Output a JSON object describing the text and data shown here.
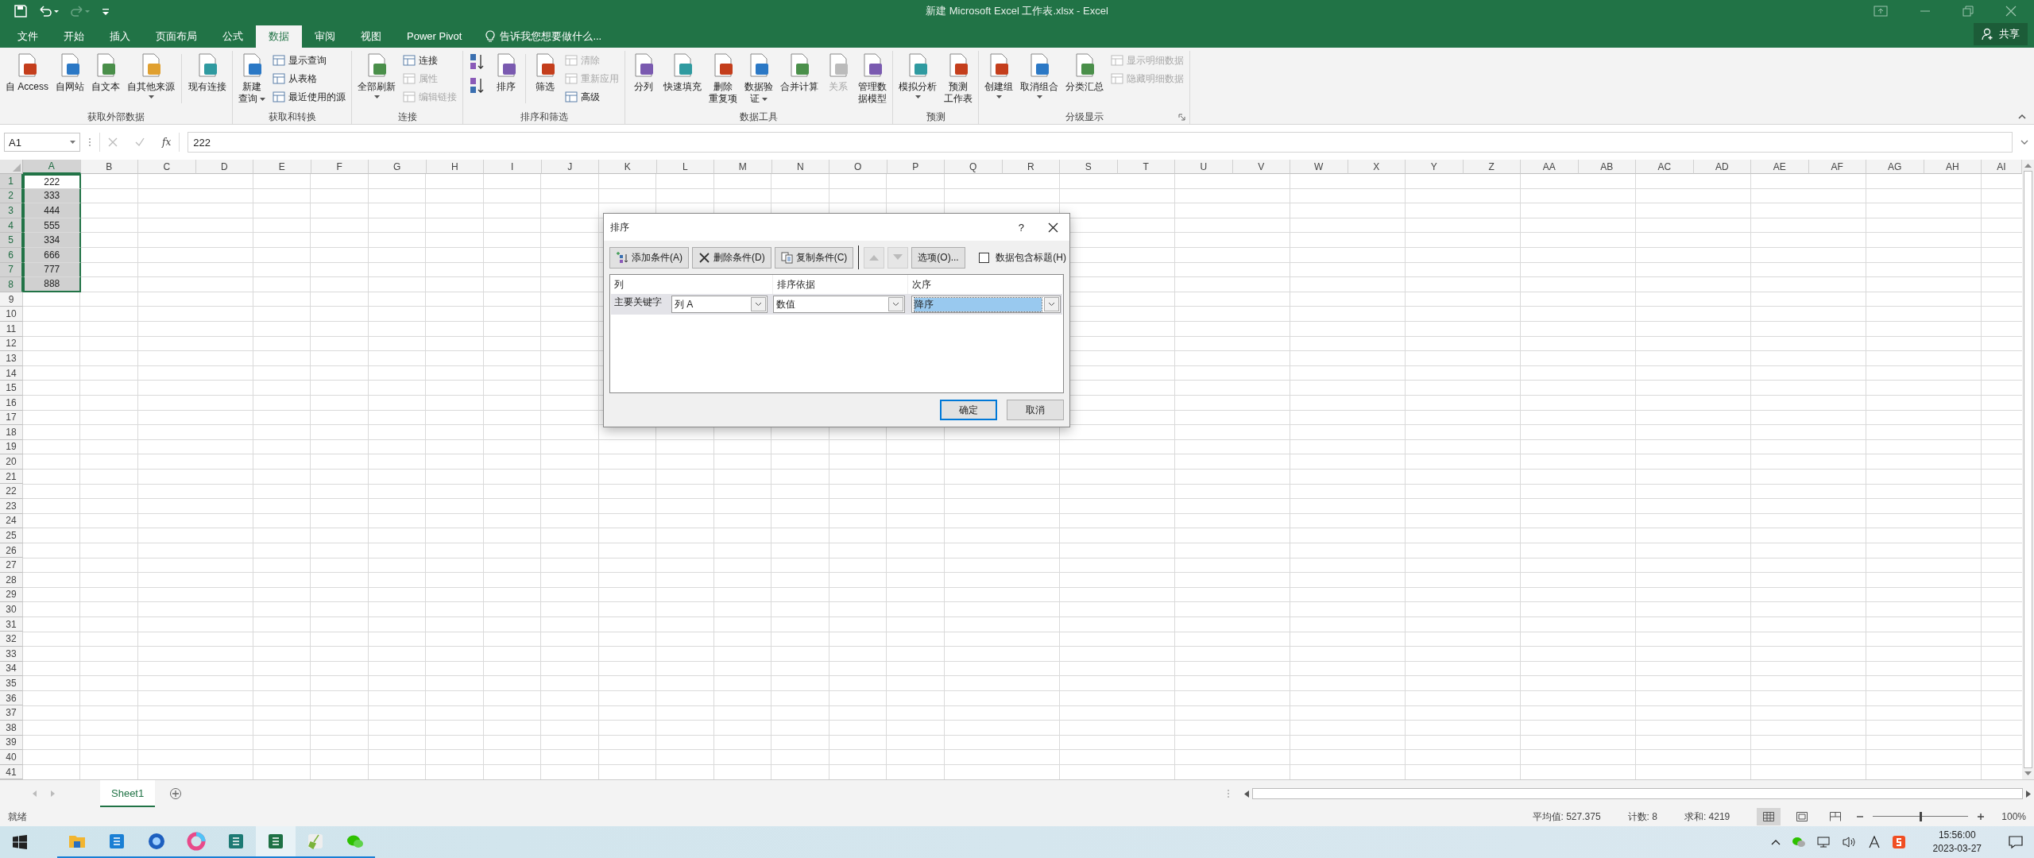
{
  "title_bar": {
    "title": "新建 Microsoft Excel 工作表.xlsx - Excel",
    "share": "共享"
  },
  "tabs": [
    {
      "label": "文件",
      "selected": false
    },
    {
      "label": "开始",
      "selected": false
    },
    {
      "label": "插入",
      "selected": false
    },
    {
      "label": "页面布局",
      "selected": false
    },
    {
      "label": "公式",
      "selected": false
    },
    {
      "label": "数据",
      "selected": true
    },
    {
      "label": "审阅",
      "selected": false
    },
    {
      "label": "视图",
      "selected": false
    },
    {
      "label": "Power Pivot",
      "selected": false
    }
  ],
  "tell_me": "告诉我您想要做什么...",
  "ribbon_groups": [
    {
      "label": "获取外部数据",
      "items": [
        {
          "kind": "large",
          "lines": [
            "自 Access"
          ],
          "disabled": false,
          "dropdown": false
        },
        {
          "kind": "large",
          "lines": [
            "自网站"
          ],
          "disabled": false,
          "dropdown": false
        },
        {
          "kind": "large",
          "lines": [
            "自文本"
          ],
          "disabled": false,
          "dropdown": false
        },
        {
          "kind": "large",
          "lines": [
            "自其他来源"
          ],
          "disabled": false,
          "dropdown": true
        },
        {
          "kind": "separator"
        },
        {
          "kind": "large",
          "lines": [
            "现有连接"
          ],
          "disabled": false,
          "dropdown": false
        }
      ]
    },
    {
      "label": "获取和转换",
      "items": [
        {
          "kind": "large",
          "lines": [
            "新建",
            "查询"
          ],
          "disabled": false,
          "dropdown": true
        },
        {
          "kind": "stack",
          "items": [
            {
              "label": "显示查询",
              "disabled": false
            },
            {
              "label": "从表格",
              "disabled": false
            },
            {
              "label": "最近使用的源",
              "disabled": false
            }
          ]
        }
      ]
    },
    {
      "label": "连接",
      "items": [
        {
          "kind": "large",
          "lines": [
            "全部刷新"
          ],
          "disabled": false,
          "dropdown": true
        },
        {
          "kind": "stack",
          "items": [
            {
              "label": "连接",
              "disabled": false
            },
            {
              "label": "属性",
              "disabled": true
            },
            {
              "label": "编辑链接",
              "disabled": true
            }
          ]
        }
      ]
    },
    {
      "label": "排序和筛选",
      "items": [
        {
          "kind": "sort_pair"
        },
        {
          "kind": "large",
          "lines": [
            "排序"
          ],
          "disabled": false,
          "dropdown": false
        },
        {
          "kind": "separator"
        },
        {
          "kind": "large",
          "lines": [
            "筛选"
          ],
          "disabled": false,
          "dropdown": false
        },
        {
          "kind": "stack",
          "items": [
            {
              "label": "清除",
              "disabled": true
            },
            {
              "label": "重新应用",
              "disabled": true
            },
            {
              "label": "高级",
              "disabled": false
            }
          ]
        }
      ]
    },
    {
      "label": "数据工具",
      "items": [
        {
          "kind": "large",
          "lines": [
            "分列"
          ],
          "disabled": false,
          "dropdown": false
        },
        {
          "kind": "large",
          "lines": [
            "快速填充"
          ],
          "disabled": false,
          "dropdown": false
        },
        {
          "kind": "large",
          "lines": [
            "删除",
            "重复项"
          ],
          "disabled": false,
          "dropdown": false
        },
        {
          "kind": "large",
          "lines": [
            "数据验",
            "证"
          ],
          "disabled": false,
          "dropdown": true
        },
        {
          "kind": "large",
          "lines": [
            "合并计算"
          ],
          "disabled": false,
          "dropdown": false
        },
        {
          "kind": "large",
          "lines": [
            "关系"
          ],
          "disabled": true,
          "dropdown": false
        },
        {
          "kind": "large",
          "lines": [
            "管理数",
            "据模型"
          ],
          "disabled": false,
          "dropdown": false
        }
      ]
    },
    {
      "label": "预测",
      "items": [
        {
          "kind": "large",
          "lines": [
            "模拟分析"
          ],
          "disabled": false,
          "dropdown": true
        },
        {
          "kind": "large",
          "lines": [
            "预测",
            "工作表"
          ],
          "disabled": false,
          "dropdown": false
        }
      ]
    },
    {
      "label": "分级显示",
      "launcher": true,
      "items": [
        {
          "kind": "large",
          "lines": [
            "创建组"
          ],
          "disabled": false,
          "dropdown": true
        },
        {
          "kind": "large",
          "lines": [
            "取消组合"
          ],
          "disabled": false,
          "dropdown": true
        },
        {
          "kind": "large",
          "lines": [
            "分类汇总"
          ],
          "disabled": false,
          "dropdown": false
        },
        {
          "kind": "stack",
          "items": [
            {
              "label": "显示明细数据",
              "disabled": true
            },
            {
              "label": "隐藏明细数据",
              "disabled": true
            }
          ]
        }
      ]
    }
  ],
  "formula_bar": {
    "name_box": "A1",
    "fx": "fx",
    "value": "222"
  },
  "sheet": {
    "columns": [
      {
        "label": "A",
        "selected": true
      },
      {
        "label": "B",
        "selected": false
      },
      {
        "label": "C",
        "selected": false
      },
      {
        "label": "D",
        "selected": false
      },
      {
        "label": "E",
        "selected": false
      },
      {
        "label": "F",
        "selected": false
      },
      {
        "label": "G",
        "selected": false
      },
      {
        "label": "H",
        "selected": false
      },
      {
        "label": "I",
        "selected": false
      },
      {
        "label": "J",
        "selected": false
      },
      {
        "label": "K",
        "selected": false
      },
      {
        "label": "L",
        "selected": false
      },
      {
        "label": "M",
        "selected": false
      },
      {
        "label": "N",
        "selected": false
      },
      {
        "label": "O",
        "selected": false
      },
      {
        "label": "P",
        "selected": false
      },
      {
        "label": "Q",
        "selected": false
      },
      {
        "label": "R",
        "selected": false
      },
      {
        "label": "S",
        "selected": false
      },
      {
        "label": "T",
        "selected": false
      },
      {
        "label": "U",
        "selected": false
      },
      {
        "label": "V",
        "selected": false
      },
      {
        "label": "W",
        "selected": false
      },
      {
        "label": "X",
        "selected": false
      },
      {
        "label": "Y",
        "selected": false
      },
      {
        "label": "Z",
        "selected": false
      },
      {
        "label": "AA",
        "selected": false
      },
      {
        "label": "AB",
        "selected": false
      },
      {
        "label": "AC",
        "selected": false
      },
      {
        "label": "AD",
        "selected": false
      },
      {
        "label": "AE",
        "selected": false
      },
      {
        "label": "AF",
        "selected": false
      },
      {
        "label": "AG",
        "selected": false
      },
      {
        "label": "AH",
        "selected": false
      },
      {
        "label": "AI",
        "selected": false
      }
    ],
    "rows": [
      {
        "label": "1",
        "selected": true,
        "cells": [
          {
            "value": "222",
            "active": true
          }
        ]
      },
      {
        "label": "2",
        "selected": true,
        "cells": [
          {
            "value": "333",
            "active": false
          }
        ]
      },
      {
        "label": "3",
        "selected": true,
        "cells": [
          {
            "value": "444",
            "active": false
          }
        ]
      },
      {
        "label": "4",
        "selected": true,
        "cells": [
          {
            "value": "555",
            "active": false
          }
        ]
      },
      {
        "label": "5",
        "selected": true,
        "cells": [
          {
            "value": "334",
            "active": false
          }
        ]
      },
      {
        "label": "6",
        "selected": true,
        "cells": [
          {
            "value": "666",
            "active": false
          }
        ]
      },
      {
        "label": "7",
        "selected": true,
        "cells": [
          {
            "value": "777",
            "active": false
          }
        ]
      },
      {
        "label": "8",
        "selected": true,
        "cells": [
          {
            "value": "888",
            "active": false
          }
        ]
      },
      {
        "label": "9",
        "selected": false
      },
      {
        "label": "10",
        "selected": false
      },
      {
        "label": "11",
        "selected": false
      },
      {
        "label": "12",
        "selected": false
      },
      {
        "label": "13",
        "selected": false
      },
      {
        "label": "14",
        "selected": false
      },
      {
        "label": "15",
        "selected": false
      },
      {
        "label": "16",
        "selected": false
      },
      {
        "label": "17",
        "selected": false
      },
      {
        "label": "18",
        "selected": false
      },
      {
        "label": "19",
        "selected": false
      },
      {
        "label": "20",
        "selected": false
      },
      {
        "label": "21",
        "selected": false
      },
      {
        "label": "22",
        "selected": false
      },
      {
        "label": "23",
        "selected": false
      },
      {
        "label": "24",
        "selected": false
      },
      {
        "label": "25",
        "selected": false
      },
      {
        "label": "26",
        "selected": false
      },
      {
        "label": "27",
        "selected": false
      },
      {
        "label": "28",
        "selected": false
      },
      {
        "label": "29",
        "selected": false
      },
      {
        "label": "30",
        "selected": false
      },
      {
        "label": "31",
        "selected": false
      },
      {
        "label": "32",
        "selected": false
      },
      {
        "label": "33",
        "selected": false
      },
      {
        "label": "34",
        "selected": false
      },
      {
        "label": "35",
        "selected": false
      },
      {
        "label": "36",
        "selected": false
      },
      {
        "label": "37",
        "selected": false
      },
      {
        "label": "38",
        "selected": false
      },
      {
        "label": "39",
        "selected": false
      },
      {
        "label": "40",
        "selected": false
      },
      {
        "label": "41",
        "selected": false
      }
    ]
  },
  "dialog": {
    "title": "排序",
    "help": "?",
    "toolbar": [
      {
        "kind": "add",
        "label": "添加条件(A)",
        "disabled": false
      },
      {
        "kind": "delete",
        "label": "删除条件(D)",
        "disabled": false
      },
      {
        "kind": "copy",
        "label": "复制条件(C)",
        "disabled": false
      },
      {
        "kind": "up",
        "disabled": true
      },
      {
        "kind": "down",
        "disabled": true
      },
      {
        "kind": "options",
        "label": "选项(O)...",
        "disabled": false
      }
    ],
    "header_checkbox": {
      "label": "数据包含标题(H)",
      "checked": false
    },
    "columns": [
      "列",
      "排序依据",
      "次序"
    ],
    "levels": [
      {
        "label": "主要关键字",
        "column": "列 A",
        "sort_on": "数值",
        "order": "降序",
        "selected": true
      }
    ],
    "buttons": [
      {
        "label": "确定",
        "default": true
      },
      {
        "label": "取消",
        "default": false
      }
    ]
  },
  "sheet_tabs": [
    {
      "label": "Sheet1",
      "selected": true
    }
  ],
  "status_bar": {
    "mode": "就绪",
    "stats": [
      "平均值: 527.375",
      "计数: 8",
      "求和: 4219"
    ],
    "views": [
      {
        "kind": "normal",
        "selected": true
      },
      {
        "kind": "page_layout",
        "selected": false
      },
      {
        "kind": "page_break",
        "selected": false
      }
    ],
    "zoom": {
      "level": 0.5,
      "reading": "100%"
    }
  },
  "taskbar": {
    "apps": [
      {
        "kind": "folder",
        "selected": false
      },
      {
        "kind": "tiles",
        "selected": false
      },
      {
        "kind": "lens",
        "selected": false
      },
      {
        "kind": "ring",
        "selected": false
      },
      {
        "kind": "reader",
        "selected": false
      },
      {
        "kind": "sheet",
        "selected": true
      },
      {
        "kind": "broom",
        "selected": false
      },
      {
        "kind": "chat",
        "selected": false
      }
    ],
    "time": "15:56:00",
    "date": "2023-03-27"
  }
}
